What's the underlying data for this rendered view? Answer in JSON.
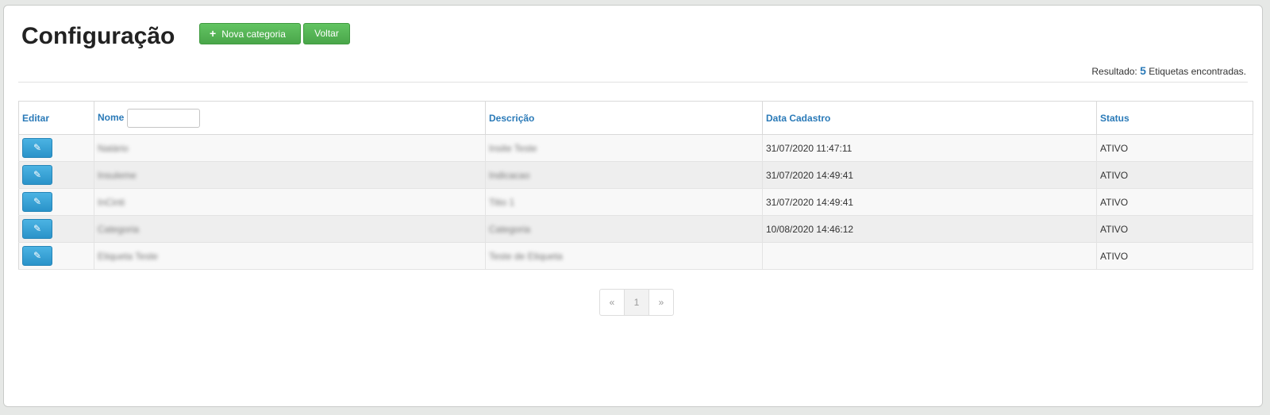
{
  "page": {
    "title": "Configuração"
  },
  "toolbar": {
    "plus_icon": "+",
    "nova_label": "Nova categoria",
    "voltar_label": "Voltar"
  },
  "resultado": {
    "prefix": "Resultado:",
    "count": "5",
    "suffix": "Etiquetas encontradas."
  },
  "table": {
    "headers": {
      "editar": "Editar",
      "nome": "Nome",
      "descricao": "Descrição",
      "data_cadastro": "Data Cadastro",
      "status": "Status"
    },
    "nome_filter_value": "",
    "edit_icon": "✎",
    "rows": [
      {
        "nome": "Natário",
        "descricao": "Insite Teste",
        "data": "31/07/2020 11:47:11",
        "status": "ATIVO"
      },
      {
        "nome": "Insuleme",
        "descricao": "Indicacao",
        "data": "31/07/2020 14:49:41",
        "status": "ATIVO"
      },
      {
        "nome": "InCinti",
        "descricao": "Titio 1",
        "data": "31/07/2020 14:49:41",
        "status": "ATIVO"
      },
      {
        "nome": "Categoria",
        "descricao": "Categoria",
        "data": "10/08/2020 14:46:12",
        "status": "ATIVO"
      },
      {
        "nome": "Etiqueta Teste",
        "descricao": "Teste de Etiqueta",
        "data": "",
        "status": "ATIVO"
      }
    ]
  },
  "pagination": {
    "prev": "«",
    "current": "1",
    "next": "»"
  }
}
